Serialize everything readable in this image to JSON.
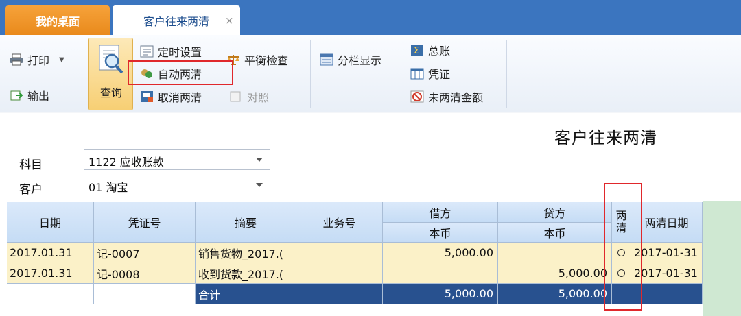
{
  "tabs": {
    "home": "我的桌面",
    "active": "客户往来两清",
    "close": "×"
  },
  "toolbar": {
    "print": "打印",
    "export": "输出",
    "query": "查询",
    "schedule_setting": "定时设置",
    "auto_clear": "自动两清",
    "cancel_clear": "取消两清",
    "balance_check": "平衡检查",
    "compare": "对照",
    "split_display": "分栏显示",
    "general_ledger": "总账",
    "voucher": "凭证",
    "uncleared_amount": "未两清金额"
  },
  "report": {
    "title": "客户往来两清"
  },
  "filters": {
    "subject_label": "科目",
    "subject_value": "1122 应收账款",
    "customer_label": "客户",
    "customer_value": "01 淘宝"
  },
  "table": {
    "headers": {
      "date": "日期",
      "voucher_no": "凭证号",
      "summary": "摘要",
      "business_no": "业务号",
      "debit": "借方",
      "credit": "贷方",
      "local_currency": "本币",
      "cleared": "两清",
      "clear_date": "两清日期"
    },
    "rows": [
      {
        "date": "2017.01.31",
        "voucher_no": "记-0007",
        "summary": "销售货物_2017.(",
        "business_no": "",
        "debit": "5,000.00",
        "credit": "",
        "clear_date": "2017-01-31"
      },
      {
        "date": "2017.01.31",
        "voucher_no": "记-0008",
        "summary": "收到货款_2017.(",
        "business_no": "",
        "debit": "",
        "credit": "5,000.00",
        "clear_date": "2017-01-31"
      }
    ],
    "total": {
      "label": "合计",
      "debit": "5,000.00",
      "credit": "5,000.00"
    }
  },
  "colors": {
    "tabbar": "#3b75bf",
    "home_tab": "#f09526",
    "row_highlight": "#fbf1c8",
    "total_row": "#28518f",
    "annotation": "#e0282c"
  }
}
